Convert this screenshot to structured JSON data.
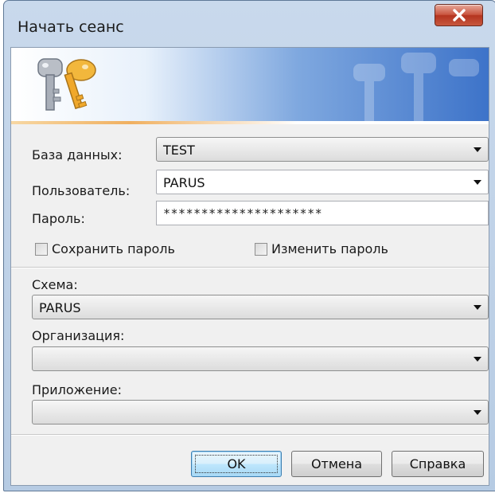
{
  "window": {
    "title": "Начать сеанс"
  },
  "login": {
    "database_label": "База данных:",
    "database_value": "TEST",
    "user_label": "Пользователь:",
    "user_value": "PARUS",
    "password_label": "Пароль:",
    "password_value": "*********************",
    "save_password_label": "Сохранить пароль",
    "change_password_label": "Изменить пароль",
    "save_password_checked": false,
    "change_password_checked": false
  },
  "context": {
    "schema_label": "Схема:",
    "schema_value": "PARUS",
    "organization_label": "Организация:",
    "organization_value": "",
    "application_label": "Приложение:",
    "application_value": ""
  },
  "buttons": {
    "ok": "OK",
    "cancel": "Отмена",
    "help": "Справка"
  },
  "icons": {
    "close": "close-icon",
    "logo": "keys-icon",
    "dropdown": "chevron-down-icon"
  },
  "colors": {
    "close_button": "#c9543e",
    "banner_blue": "#3d73c9",
    "banner_accent": "#f0b060",
    "default_button": "#3c7fb1"
  }
}
